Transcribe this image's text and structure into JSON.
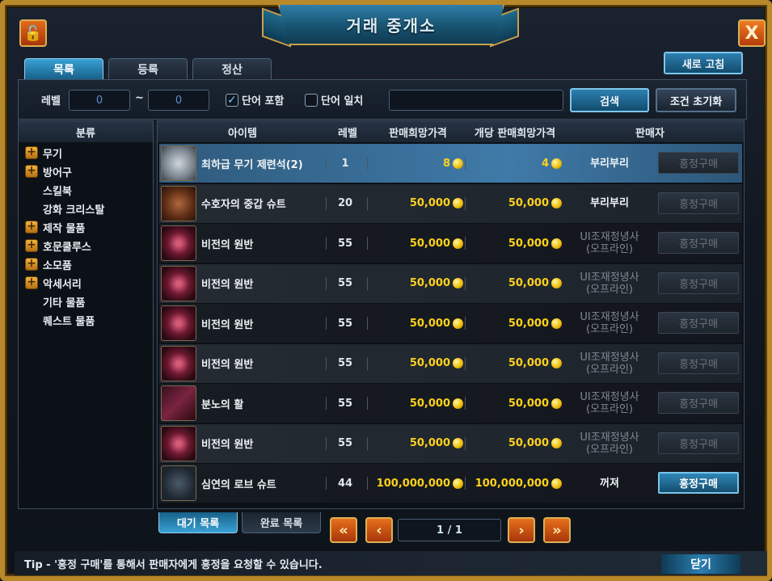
{
  "window": {
    "title": "거래 중개소"
  },
  "corner": {
    "lock_icon": "🔓",
    "close_icon": "X"
  },
  "tabs": {
    "list": "목록",
    "register": "등록",
    "settle": "정산"
  },
  "refresh_label": "새로 고침",
  "search": {
    "level_label": "레벨",
    "level_min": "0",
    "tilde": "~",
    "level_max": "0",
    "contains_label": "단어 포함",
    "contains_checked": true,
    "exact_label": "단어 일치",
    "exact_checked": false,
    "keyword": "",
    "search_label": "검색",
    "reset_label": "조건 초기화"
  },
  "categories": {
    "header": "분류",
    "items": [
      {
        "label": "무기",
        "expandable": true
      },
      {
        "label": "방어구",
        "expandable": true
      },
      {
        "label": "스킬북",
        "expandable": false
      },
      {
        "label": "강화 크리스탈",
        "expandable": false
      },
      {
        "label": "제작 물품",
        "expandable": true
      },
      {
        "label": "호문쿨루스",
        "expandable": true
      },
      {
        "label": "소모품",
        "expandable": true
      },
      {
        "label": "악세서리",
        "expandable": true
      },
      {
        "label": "기타 물품",
        "expandable": false
      },
      {
        "label": "퀘스트 물품",
        "expandable": false
      }
    ]
  },
  "table": {
    "headers": {
      "item": "아이템",
      "level": "레벨",
      "price": "판매희망가격",
      "unit_price": "개당 판매희망가격",
      "seller": "판매자"
    },
    "buy_label": "흥정구매",
    "rows": [
      {
        "name": "최하급 무기 제련석(2)",
        "level": "1",
        "price": "8",
        "unit": "4",
        "seller": "부리부리",
        "seller2": "",
        "online": true,
        "buyable": false,
        "icon": "stone",
        "icon_name": "stone-icon"
      },
      {
        "name": "수호자의 중갑 슈트",
        "level": "20",
        "price": "50,000",
        "unit": "50,000",
        "seller": "부리부리",
        "seller2": "",
        "online": true,
        "buyable": false,
        "icon": "armor",
        "icon_name": "armor-icon"
      },
      {
        "name": "비전의 원반",
        "level": "55",
        "price": "50,000",
        "unit": "50,000",
        "seller": "UI조재정녕사",
        "seller2": "(오프라인)",
        "online": false,
        "buyable": false,
        "icon": "disc",
        "icon_name": "disc-icon"
      },
      {
        "name": "비전의 원반",
        "level": "55",
        "price": "50,000",
        "unit": "50,000",
        "seller": "UI조재정녕사",
        "seller2": "(오프라인)",
        "online": false,
        "buyable": false,
        "icon": "disc",
        "icon_name": "disc-icon"
      },
      {
        "name": "비전의 원반",
        "level": "55",
        "price": "50,000",
        "unit": "50,000",
        "seller": "UI조재정녕사",
        "seller2": "(오프라인)",
        "online": false,
        "buyable": false,
        "icon": "disc",
        "icon_name": "disc-icon"
      },
      {
        "name": "비전의 원반",
        "level": "55",
        "price": "50,000",
        "unit": "50,000",
        "seller": "UI조재정녕사",
        "seller2": "(오프라인)",
        "online": false,
        "buyable": false,
        "icon": "disc",
        "icon_name": "disc-icon"
      },
      {
        "name": "분노의 활",
        "level": "55",
        "price": "50,000",
        "unit": "50,000",
        "seller": "UI조재정녕사",
        "seller2": "(오프라인)",
        "online": false,
        "buyable": false,
        "icon": "bow",
        "icon_name": "bow-icon"
      },
      {
        "name": "비전의 원반",
        "level": "55",
        "price": "50,000",
        "unit": "50,000",
        "seller": "UI조재정녕사",
        "seller2": "(오프라인)",
        "online": false,
        "buyable": false,
        "icon": "disc",
        "icon_name": "disc-icon"
      },
      {
        "name": "심연의 로브 슈트",
        "level": "44",
        "price": "100,000,000",
        "unit": "100,000,000",
        "seller": "꺼져",
        "seller2": "",
        "online": true,
        "buyable": true,
        "icon": "robe",
        "icon_name": "robe-icon"
      }
    ]
  },
  "bottom_tabs": {
    "waiting": "대기 목록",
    "completed": "완료 목록"
  },
  "paging": {
    "first": "«",
    "prev": "‹",
    "indicator": "1 / 1",
    "next": "›",
    "last": "»"
  },
  "tip": "Tip - '흥정 구매'를 통해서 판매자에게 흥정을 요청할 수 있습니다.",
  "close_label": "닫기",
  "colors": {
    "frame_gold": "#b8892a",
    "accent_blue": "#2d7fb0",
    "price_yellow": "#ffd21a",
    "offline_gray": "#7f8891"
  }
}
